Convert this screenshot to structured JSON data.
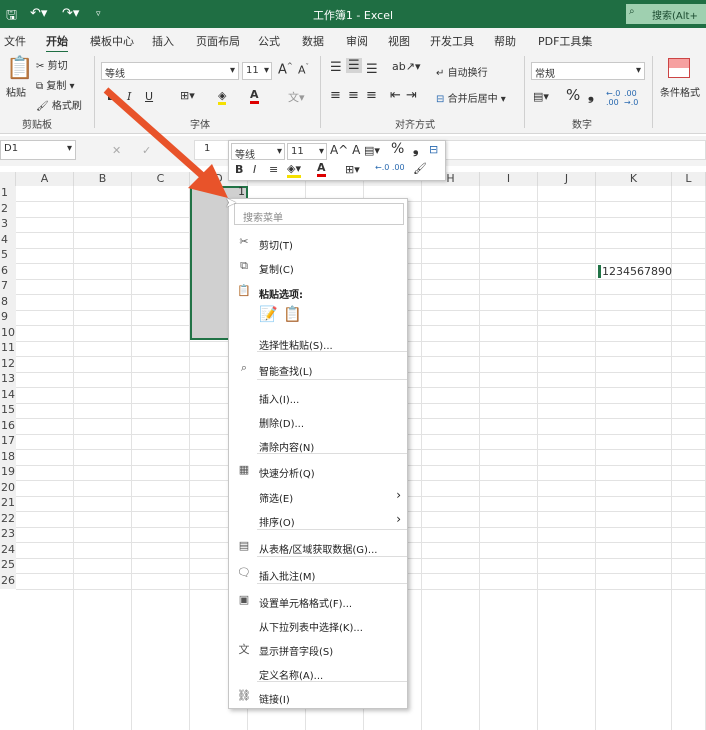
{
  "titlebar": {
    "title": "工作簿1 - Excel",
    "search": "搜索(Alt+"
  },
  "tabs": [
    "文件",
    "开始",
    "模板中心",
    "插入",
    "页面布局",
    "公式",
    "数据",
    "审阅",
    "视图",
    "开发工具",
    "帮助",
    "PDF工具集"
  ],
  "ribbon": {
    "clipboard": {
      "paste": "粘贴",
      "cut": "剪切",
      "copy": "复制",
      "painter": "格式刷",
      "label": "剪贴板"
    },
    "font": {
      "name": "等线",
      "size": "11",
      "bold": "B",
      "italic": "I",
      "underline": "U",
      "label": "字体"
    },
    "align": {
      "wrap": "自动换行",
      "merge": "合并后居中",
      "label": "对齐方式"
    },
    "number": {
      "format": "常规",
      "percent": "%",
      "comma": "❟",
      "label": "数字"
    },
    "styles": {
      "conditional": "条件格式"
    }
  },
  "formula": {
    "namebox": "D1",
    "value": "1"
  },
  "mini": {
    "font": "等线",
    "size": "11",
    "percent": "%"
  },
  "columns": [
    "A",
    "B",
    "C",
    "D",
    "",
    "",
    "",
    "H",
    "I",
    "J",
    "K",
    "L"
  ],
  "rows": [
    "1",
    "2",
    "3",
    "4",
    "5",
    "6",
    "7",
    "8",
    "9",
    "10",
    "11",
    "12",
    "13",
    "14",
    "15",
    "16",
    "17",
    "18",
    "19",
    "20",
    "21",
    "22",
    "23",
    "24",
    "25",
    "26"
  ],
  "cells": {
    "D1": "1",
    "K6": "1234567890"
  },
  "menu": {
    "search_placeholder": "搜索菜单",
    "items": [
      {
        "label": "剪切(T)",
        "icon": "scissors"
      },
      {
        "label": "复制(C)",
        "icon": "copy"
      },
      {
        "label": "粘贴选项:",
        "icon": "paste"
      },
      {
        "label": "选择性粘贴(S)...",
        "icon": ""
      },
      {
        "label": "智能查找(L)",
        "icon": "search"
      },
      {
        "label": "插入(I)...",
        "icon": ""
      },
      {
        "label": "删除(D)...",
        "icon": ""
      },
      {
        "label": "清除内容(N)",
        "icon": ""
      },
      {
        "label": "快速分析(Q)",
        "icon": "quick-analysis"
      },
      {
        "label": "筛选(E)",
        "icon": "",
        "submenu": true
      },
      {
        "label": "排序(O)",
        "icon": "",
        "submenu": true
      },
      {
        "label": "从表格/区域获取数据(G)...",
        "icon": "table"
      },
      {
        "label": "插入批注(M)",
        "icon": "comment"
      },
      {
        "label": "设置单元格格式(F)...",
        "icon": "format-cells"
      },
      {
        "label": "从下拉列表中选择(K)...",
        "icon": ""
      },
      {
        "label": "显示拼音字段(S)",
        "icon": "phonetic"
      },
      {
        "label": "定义名称(A)...",
        "icon": ""
      },
      {
        "label": "链接(I)",
        "icon": "link"
      }
    ]
  },
  "colors": {
    "excel_green": "#1f6e43",
    "arrow": "#e8532a"
  }
}
